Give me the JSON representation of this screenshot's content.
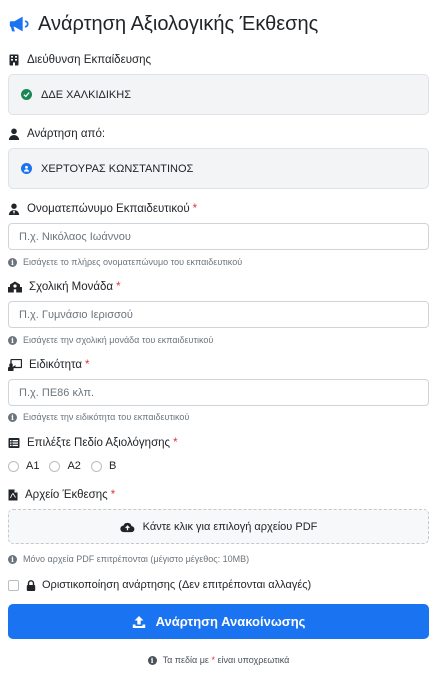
{
  "header": {
    "title": "Ανάρτηση Αξιολογικής Έκθεσης",
    "icon": "megaphone-icon",
    "accent": "#1a73f0"
  },
  "directorate": {
    "label": "Διεύθυνση Εκπαίδευσης",
    "value": "ΔΔΕ ΧΑΛΚΙΔΙΚΗΣ",
    "icon": "building-icon",
    "status_icon": "check-circle-icon",
    "status_color": "#198754"
  },
  "posted_by": {
    "label": "Ανάρτηση από:",
    "value": "ΧΕΡΤΟΥΡΑΣ ΚΩΝΣΤΑΝΤΙΝΟΣ",
    "icon": "user-icon",
    "status_icon": "user-circle-icon",
    "status_color": "#1a73f0"
  },
  "teacher_name": {
    "label": "Ονοματεπώνυμο Εκπαιδευτικού",
    "required": "*",
    "placeholder": "Π.χ. Νικόλαος Ιωάννου",
    "hint": "Εισάγετε το πλήρες ονοματεπώνυμο του εκπαιδευτικού",
    "icon": "user-tie-icon"
  },
  "school": {
    "label": "Σχολική Μονάδα",
    "required": "*",
    "placeholder": "Π.χ. Γυμνάσιο Ιερισσού",
    "hint": "Εισάγετε την σχολική μονάδα του εκπαιδευτικού",
    "icon": "school-icon"
  },
  "specialty": {
    "label": "Ειδικότητα",
    "required": "*",
    "placeholder": "Π.χ. ΠΕ86 κλπ.",
    "hint": "Εισάγετε την ειδικότητα του εκπαιδευτικού",
    "icon": "chalkboard-teacher-icon"
  },
  "evaluation_field": {
    "label": "Επιλέξτε Πεδίο Αξιολόγησης",
    "required": "*",
    "icon": "list-icon",
    "options": [
      "A1",
      "A2",
      "B"
    ]
  },
  "report_file": {
    "label": "Αρχείο Έκθεσης",
    "required": "*",
    "icon": "file-pdf-icon",
    "upload_label": "Κάντε κλικ για επιλογή αρχείου PDF",
    "hint": "Μόνο αρχεία PDF επιτρέπονται (μέγιστο μέγεθος: 10MB)"
  },
  "finalize": {
    "label": "Οριστικοποίηση ανάρτησης (Δεν επιτρέπονται αλλαγές)",
    "icon": "lock-icon"
  },
  "submit": {
    "label": "Ανάρτηση Ανακοίνωσης",
    "icon": "upload-icon"
  },
  "footer": {
    "note_prefix": "Τα πεδία με",
    "note_star": "*",
    "note_suffix": "είναι υποχρεωτικά"
  }
}
